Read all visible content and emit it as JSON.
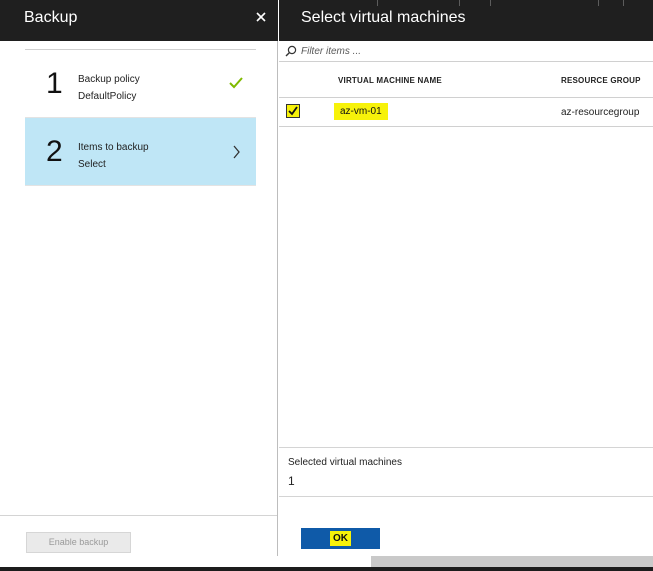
{
  "backup_blade": {
    "title": "Backup",
    "steps": [
      {
        "number": "1",
        "title": "Backup policy",
        "subtitle": "DefaultPolicy",
        "status": "complete",
        "status_icon": "checkmark-icon"
      },
      {
        "number": "2",
        "title": "Items to backup",
        "subtitle": "Select",
        "status": "active",
        "status_icon": "chevron-right-icon"
      }
    ],
    "enable_button_label": "Enable backup",
    "enable_button_disabled": true
  },
  "vm_blade": {
    "title": "Select virtual machines",
    "filter_placeholder": "Filter items ...",
    "columns": [
      "VIRTUAL MACHINE NAME",
      "RESOURCE GROUP"
    ],
    "rows": [
      {
        "name": "az-vm-01",
        "resource_group": "az-resourcegroup",
        "checked": true
      }
    ],
    "selected_label": "Selected virtual machines",
    "selected_count": "1",
    "ok_label": "OK"
  },
  "colors": {
    "header_bg": "#1f1f1f",
    "active_step_bg": "#bfe6f6",
    "check_green": "#7fba00",
    "highlight_yellow": "#f7f20a",
    "ok_button_bg": "#0f5aa8"
  }
}
